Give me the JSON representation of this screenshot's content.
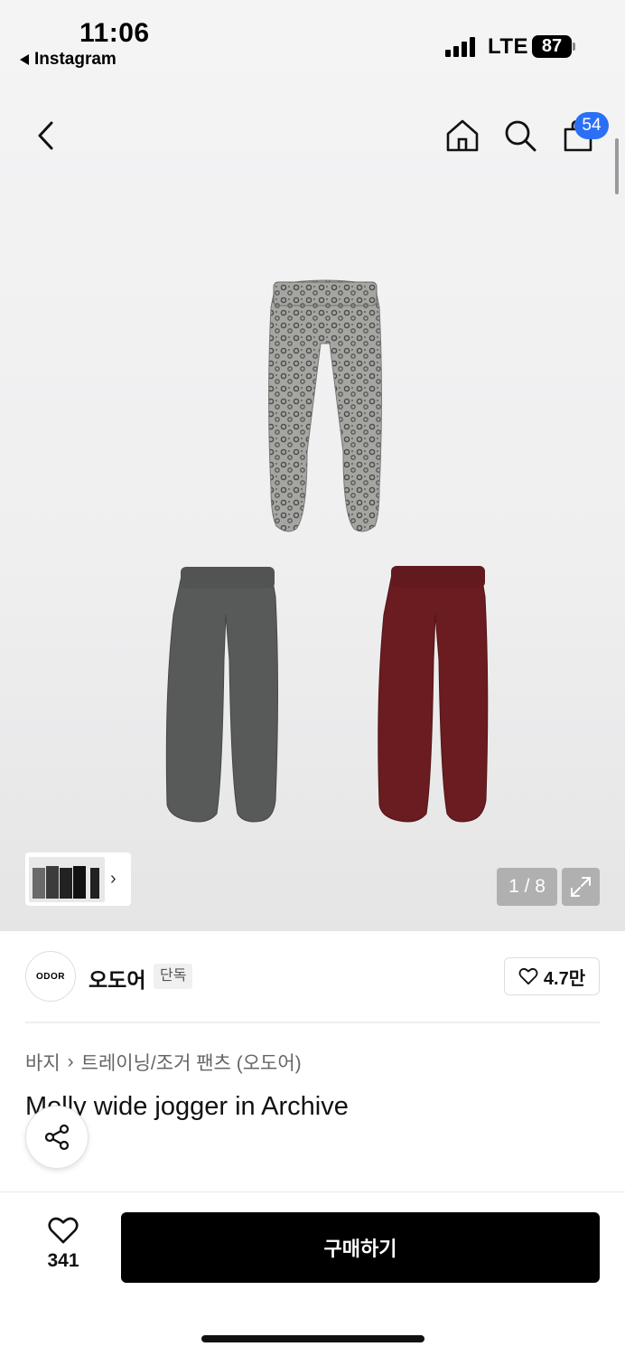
{
  "status_bar": {
    "time": "11:06",
    "back_app": "Instagram",
    "network": "LTE",
    "battery": "87"
  },
  "nav": {
    "cart_count": "54"
  },
  "gallery": {
    "page_counter": "1 / 8",
    "colors": [
      "#8c8c8a",
      "#5a5c5c",
      "#6a1c20"
    ]
  },
  "brand": {
    "logo_text": "ODOR",
    "name": "오도어",
    "tag": "단독",
    "likes": "4.7만"
  },
  "breadcrumb": {
    "category": "바지",
    "subcategory": "트레이닝/조거 팬츠 (오도어)"
  },
  "product": {
    "title": "Molly wide jogger in Archive"
  },
  "purchase_bar": {
    "wish_count": "341",
    "buy_label": "구매하기"
  }
}
